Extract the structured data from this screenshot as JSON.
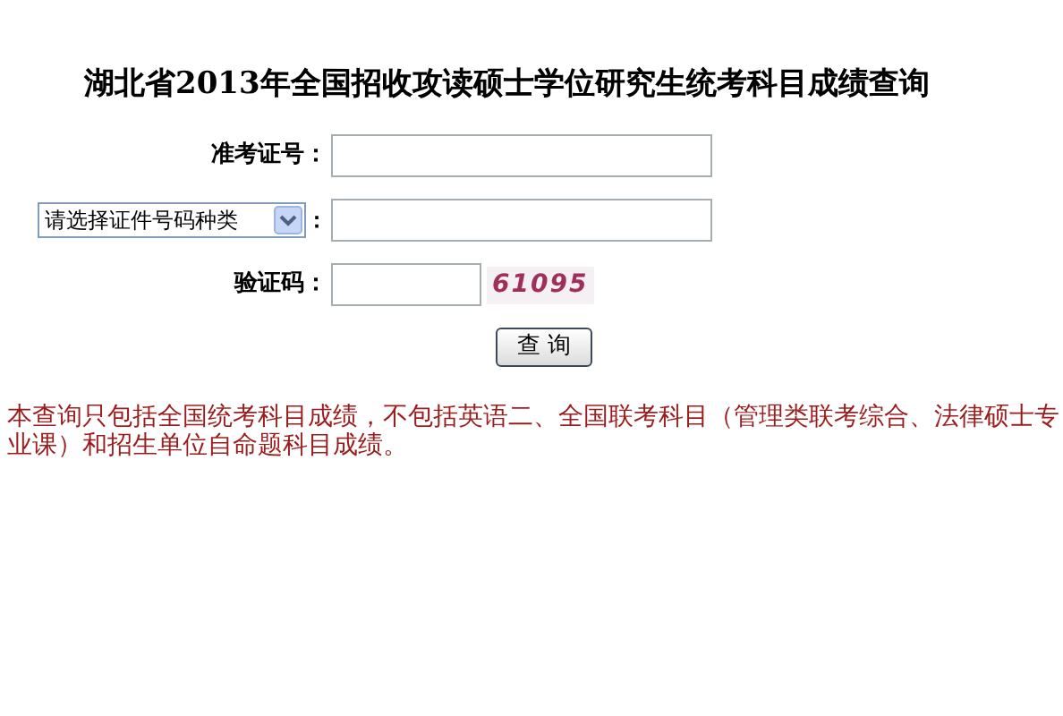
{
  "title": "湖北省2013年全国招收攻读硕士学位研究生统考科目成绩查询",
  "form": {
    "exam_number_label": "准考证号：",
    "id_type_select": "请选择证件号码种类",
    "id_type_colon": "：",
    "captcha_label": "验证码：",
    "captcha": "61095",
    "submit_button": "查 询"
  },
  "notice": "本查询只包括全国统考科目成绩，不包括英语二、全国联考科目（管理类联考综合、法律硕士专业课）和招生单位自命题科目成绩。"
}
